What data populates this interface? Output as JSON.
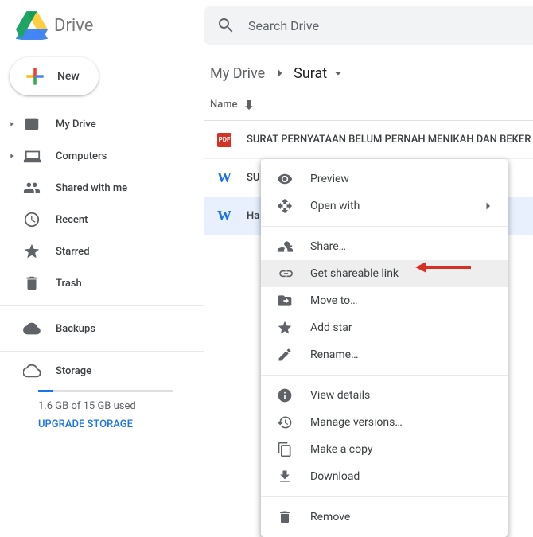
{
  "header": {
    "app_name": "Drive",
    "search_placeholder": "Search Drive"
  },
  "new_button": {
    "label": "New"
  },
  "sidebar": {
    "items": [
      {
        "label": "My Drive",
        "expandable": true
      },
      {
        "label": "Computers",
        "expandable": true
      },
      {
        "label": "Shared with me",
        "expandable": false
      },
      {
        "label": "Recent",
        "expandable": false
      },
      {
        "label": "Starred",
        "expandable": false
      },
      {
        "label": "Trash",
        "expandable": false
      }
    ],
    "backups": {
      "label": "Backups"
    },
    "storage": {
      "label": "Storage",
      "used_text": "1.6 GB of 15 GB used",
      "upgrade": "UPGRADE STORAGE",
      "percent": 10.6
    }
  },
  "breadcrumb": {
    "root": "My Drive",
    "current": "Surat"
  },
  "column": {
    "name": "Name"
  },
  "files": [
    {
      "type": "pdf",
      "name": "SURAT PERNYATAAN BELUM PERNAH MENIKAH DAN BEKER"
    },
    {
      "type": "word",
      "name": "SU"
    },
    {
      "type": "word",
      "name": "Ha",
      "selected": true
    }
  ],
  "context_menu": {
    "items": [
      {
        "label": "Preview",
        "icon": "eye"
      },
      {
        "label": "Open with",
        "icon": "openwith",
        "submenu": true
      }
    ],
    "items2": [
      {
        "label": "Share…",
        "icon": "share"
      },
      {
        "label": "Get shareable link",
        "icon": "link",
        "highlight": true
      },
      {
        "label": "Move to…",
        "icon": "moveto"
      },
      {
        "label": "Add star",
        "icon": "star"
      },
      {
        "label": "Rename…",
        "icon": "rename"
      }
    ],
    "items3": [
      {
        "label": "View details",
        "icon": "info"
      },
      {
        "label": "Manage versions…",
        "icon": "history"
      },
      {
        "label": "Make a copy",
        "icon": "copy"
      },
      {
        "label": "Download",
        "icon": "download"
      }
    ],
    "items4": [
      {
        "label": "Remove",
        "icon": "trash"
      }
    ]
  }
}
